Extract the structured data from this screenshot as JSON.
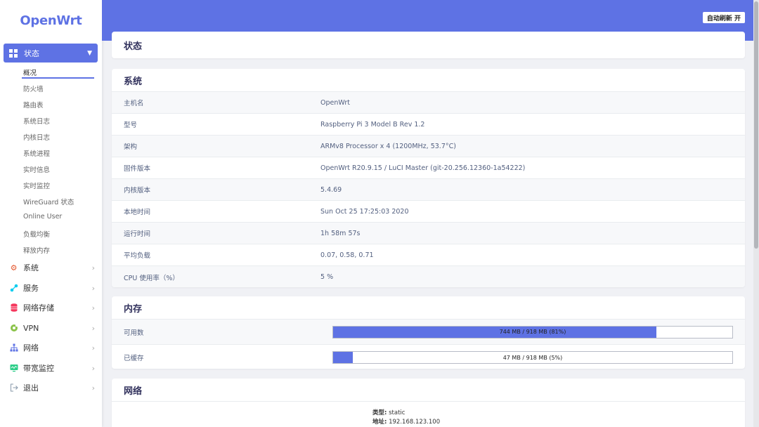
{
  "brand": "OpenWrt",
  "sidebar": {
    "active_menu": "状态",
    "submenu": [
      "概况",
      "防火墙",
      "路由表",
      "系统日志",
      "内核日志",
      "系统进程",
      "实时信息",
      "实时监控",
      "WireGuard 状态",
      "Online User",
      "负载均衡",
      "释放内存"
    ],
    "menu_items": [
      {
        "label": "系统",
        "icon": "gear-icon",
        "color": "#e4572e"
      },
      {
        "label": "服务",
        "icon": "nodes-icon",
        "color": "#11cdef"
      },
      {
        "label": "网络存储",
        "icon": "database-icon",
        "color": "#f5365c"
      },
      {
        "label": "VPN",
        "icon": "vpn-icon",
        "color": "#8bc34a"
      },
      {
        "label": "网络",
        "icon": "sitemap-icon",
        "color": "#5e72e4"
      },
      {
        "label": "带宽监控",
        "icon": "monitor-icon",
        "color": "#2dce89"
      },
      {
        "label": "退出",
        "icon": "logout-icon",
        "color": "#8898aa"
      }
    ]
  },
  "header": {
    "refresh_button": "自动刷新 开"
  },
  "page_title": "状态",
  "system": {
    "title": "系统",
    "rows": [
      {
        "key": "主机名",
        "value": "OpenWrt"
      },
      {
        "key": "型号",
        "value": "Raspberry Pi 3 Model B Rev 1.2"
      },
      {
        "key": "架构",
        "value": "ARMv8 Processor x 4 (1200MHz, 53.7°C)"
      },
      {
        "key": "固件版本",
        "value": "OpenWrt R20.9.15 / LuCI Master (git-20.256.12360-1a54222)"
      },
      {
        "key": "内核版本",
        "value": "5.4.69"
      },
      {
        "key": "本地时间",
        "value": "Sun Oct 25 17:25:03 2020"
      },
      {
        "key": "运行时间",
        "value": "1h 58m 57s"
      },
      {
        "key": "平均负载",
        "value": "0.07, 0.58, 0.71"
      },
      {
        "key": "CPU 使用率（%）",
        "value": "5 %"
      }
    ]
  },
  "memory": {
    "title": "内存",
    "available": {
      "label": "可用数",
      "text": "744 MB / 918 MB (81%)",
      "percent": 81
    },
    "cached": {
      "label": "已缓存",
      "text": "47 MB / 918 MB (5%)",
      "percent": 5
    }
  },
  "network": {
    "title": "网络",
    "type_label": "类型:",
    "type_value": "static",
    "address_label": "地址:",
    "address_value": "192.168.123.100"
  }
}
